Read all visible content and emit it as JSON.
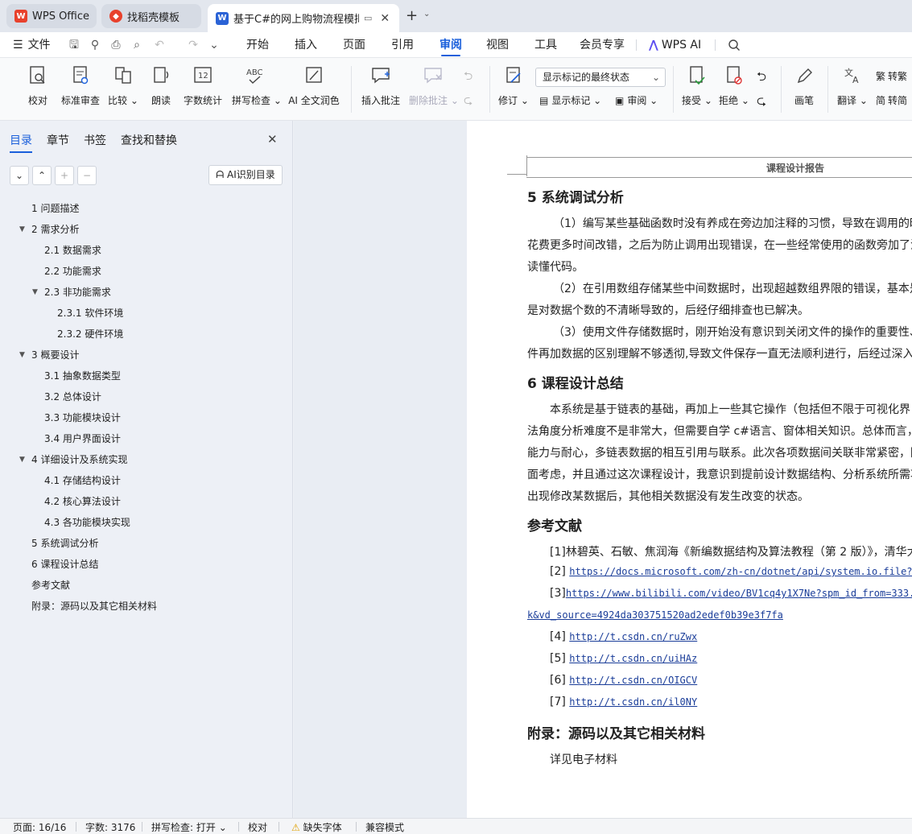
{
  "tabs": [
    {
      "label": "WPS Office",
      "icon": "wps-logo-icon"
    },
    {
      "label": "找稻壳模板",
      "icon": "docer-logo-icon"
    },
    {
      "label": "基于C#的网上购物流程模拟",
      "icon": "word-doc-icon"
    }
  ],
  "menubar": {
    "file": "文件",
    "items": [
      "开始",
      "插入",
      "页面",
      "引用",
      "审阅",
      "视图",
      "工具",
      "会员专享"
    ],
    "active": "审阅",
    "ai": "WPS AI"
  },
  "ribbon": {
    "proofread": "校对",
    "standard_review": "标准审查",
    "compare": "比较",
    "read_aloud": "朗读",
    "word_count": "字数统计",
    "spell_check": "拼写检查",
    "ai_polish": "AI 全文润色",
    "insert_comment": "插入批注",
    "delete_comment": "删除批注",
    "display_mode_select": "显示标记的最终状态",
    "track_changes": "修订",
    "show_markup": "显示标记",
    "review": "审阅",
    "accept": "接受",
    "reject": "拒绝",
    "ink": "画笔",
    "translate": "翻译",
    "to_traditional": "转繁",
    "to_simplified": "转简"
  },
  "nav": {
    "tabs": [
      "目录",
      "章节",
      "书签",
      "查找和替换"
    ],
    "ai_toc": "AI识别目录",
    "toc": [
      {
        "label": "1  问题描述",
        "level": 1,
        "expander": false
      },
      {
        "label": "2  需求分析",
        "level": 1,
        "expander": true
      },
      {
        "label": "2.1  数据需求",
        "level": 2,
        "expander": false
      },
      {
        "label": "2.2  功能需求",
        "level": 2,
        "expander": false
      },
      {
        "label": "2.3  非功能需求",
        "level": 2,
        "expander": true
      },
      {
        "label": "2.3.1 软件环境",
        "level": 3,
        "expander": false
      },
      {
        "label": "2.3.2 硬件环境",
        "level": 3,
        "expander": false
      },
      {
        "label": "3  概要设计",
        "level": 1,
        "expander": true
      },
      {
        "label": "3.1 抽象数据类型",
        "level": 2,
        "expander": false
      },
      {
        "label": "3.2  总体设计",
        "level": 2,
        "expander": false
      },
      {
        "label": "3.3  功能模块设计",
        "level": 2,
        "expander": false
      },
      {
        "label": "3.4  用户界面设计",
        "level": 2,
        "expander": false
      },
      {
        "label": "4  详细设计及系统实现",
        "level": 1,
        "expander": true
      },
      {
        "label": "4.1  存储结构设计",
        "level": 2,
        "expander": false
      },
      {
        "label": "4.2  核心算法设计",
        "level": 2,
        "expander": false
      },
      {
        "label": "4.3  各功能模块实现",
        "level": 2,
        "expander": false
      },
      {
        "label": "5  系统调试分析",
        "level": 1,
        "expander": false
      },
      {
        "label": "6  课程设计总结",
        "level": 1,
        "expander": false
      },
      {
        "label": "参考文献",
        "level": 1,
        "expander": false
      },
      {
        "label": "附录：源码以及其它相关材料",
        "level": 1,
        "expander": false
      }
    ]
  },
  "document": {
    "header": "课程设计报告",
    "h5": "5  系统调试分析",
    "p5": [
      "（1）编写某些基础函数时没有养成在旁边加注释的习惯，导致在调用的时",
      "花费更多时间改错，之后为防止调用出现错误，在一些经常使用的函数旁加了注",
      "读懂代码。",
      "（2）在引用数组存储某些中间数据时，出现超越数组界限的错误，基本是",
      "是对数据个数的不清晰导致的，后经仔细排查也已解决。",
      "（3）使用文件存储数据时，刚开始没有意识到关闭文件的操作的重要性、",
      "件再加数据的区别理解不够透彻,导致文件保存一直无法顺利进行，后经过深入"
    ],
    "h6": "6  课程设计总结",
    "p6": [
      "本系统是基于链表的基础，再加上一些其它操作（包括但不限于可视化界",
      "法角度分析难度不是非常大，但需要自学 c#语言、窗体相关知识。总体而言，此",
      "能力与耐心，多链表数据的相互引用与联系。此次各项数据间关联非常紧密，因",
      "面考虑，并且通过这次课程设计，我意识到提前设计数据结构、分析系统所需功",
      "出现修改某数据后，其他相关数据没有发生改变的状态。"
    ],
    "href": "参考文献",
    "refs": [
      {
        "prefix": "[1]林碧英、石敏、焦润海《新编数据结构及算法教程（第 2 版）》，清华大",
        "url": ""
      },
      {
        "prefix": "[2] ",
        "url": "https://docs.microsoft.com/zh-cn/dotnet/api/system.io.file?vi"
      },
      {
        "prefix": "[3]",
        "url": "https://www.bilibili.com/video/BV1cq4y1X7Ne?spm_id_from=333.33"
      },
      {
        "prefix": "",
        "url": "k&vd_source=4924da303751520ad2edef0b39e3f7fa"
      },
      {
        "prefix": "[4] ",
        "url": "http://t.csdn.cn/ruZwx"
      },
      {
        "prefix": "[5] ",
        "url": "http://t.csdn.cn/uiHAz"
      },
      {
        "prefix": "[6] ",
        "url": "http://t.csdn.cn/OIGCV"
      },
      {
        "prefix": "[7] ",
        "url": "http://t.csdn.cn/il0NY"
      }
    ],
    "happ": "附录：源码以及其它相关材料",
    "papp": "详见电子材料"
  },
  "status": {
    "page": "页面: 16/16",
    "words": "字数: 3176",
    "spell": "拼写检查: 打开",
    "proof": "校对",
    "missing_font": "缺失字体",
    "compat": "兼容模式"
  },
  "colors": {
    "accent": "#1a5fdb",
    "wps_red": "#e8412c",
    "word_blue": "#2b63d6"
  }
}
